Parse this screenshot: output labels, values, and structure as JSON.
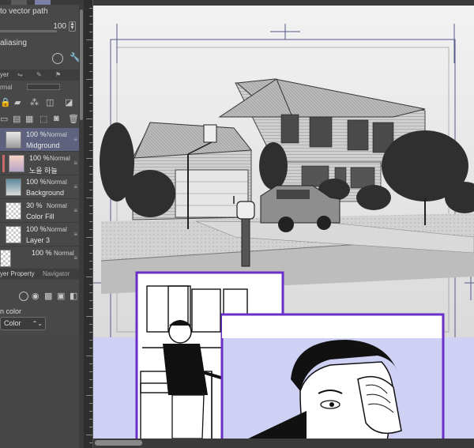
{
  "tool_property": {
    "convert_label": "to vector path",
    "value": "100",
    "antialias_label": "aliasing"
  },
  "layer_panel": {
    "tab_label": "yer",
    "blend_mode": "rmal",
    "layers": [
      {
        "opacity": "100 %",
        "mode": "Normal",
        "name": "Midground",
        "selected": true
      },
      {
        "opacity": "100 %",
        "mode": "Normal",
        "name": "노을 하늘",
        "selected": false
      },
      {
        "opacity": "100 %",
        "mode": "Normal",
        "name": "Background",
        "selected": false
      },
      {
        "opacity": "30 %",
        "mode": "Normal",
        "name": "Color Fill",
        "selected": false
      },
      {
        "opacity": "100 %",
        "mode": "Normal",
        "name": "Layer 3",
        "selected": false
      },
      {
        "opacity": "100 %",
        "mode": "Normal",
        "name": "",
        "selected": false
      }
    ]
  },
  "bottom_tabs": {
    "layer_property": "yer Property",
    "navigator": "Navigator"
  },
  "layer_property": {
    "color_label": "n color",
    "color_select": "Color"
  },
  "colors": {
    "panel_bg": "#484848",
    "selected_layer": "#5e627e",
    "accent_purple": "#6a2fc9",
    "color_fill_lavender": "#ced0f4"
  }
}
